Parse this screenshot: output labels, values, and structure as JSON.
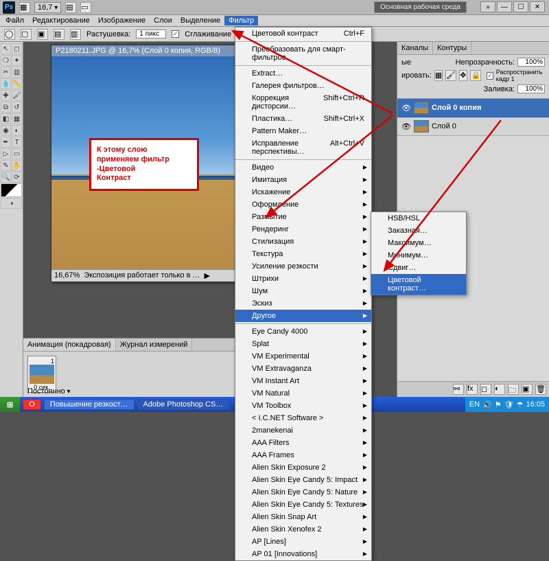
{
  "top": {
    "zoom_field": "16,7",
    "workspace_badge": "Основная рабочая среда"
  },
  "menu": {
    "file": "Файл",
    "edit": "Редактирование",
    "image": "Изображение",
    "layer": "Слои",
    "select": "Выделение",
    "filter": "Фильтр"
  },
  "options": {
    "feather_label": "Растушевка:",
    "feather_val": "1 пикс",
    "antialias": "Сглаживание"
  },
  "doc": {
    "title": "P2180211.JPG @ 16,7% (Слой 0 копия, RGB/8)",
    "zoom": "16,67%",
    "status": "Экспозиция работает только в …"
  },
  "annot": {
    "l1": "К этому слою",
    "l2": "применяем фильтр",
    "l3": "-Цветовой",
    "l4": "Контраст"
  },
  "panels": {
    "tab_channels": "Каналы",
    "tab_paths": "Контуры",
    "tab_layers_hint": "ые",
    "opacity_label": "Непрозрачность:",
    "opacity_val": "100%",
    "fill_label": "Заливка:",
    "fill_val": "100%",
    "lock_label": "ировать:",
    "propagate": "Распространить кадр 1",
    "layer_top": "Слой 0 копия",
    "layer_bottom": "Слой 0"
  },
  "anim": {
    "tab1": "Анимация (покадровая)",
    "tab2": "Журнал измерений",
    "frame_num": "1",
    "frame_time": "0 сек.",
    "loop": "Постоянно"
  },
  "filter_menu": {
    "last": "Цветовой контраст",
    "last_sc": "Ctrl+F",
    "smart": "Преобразовать для смарт-фильтров",
    "extract": "Extract…",
    "gallery": "Галерея фильтров…",
    "lens": "Коррекция дисторсии…",
    "lens_sc": "Shift+Ctrl+R",
    "liquify": "Пластика…",
    "liquify_sc": "Shift+Ctrl+X",
    "pattern": "Pattern Maker…",
    "vanish": "Исправление перспективы…",
    "vanish_sc": "Alt+Ctrl+V",
    "g_video": "Видео",
    "g_imit": "Имитация",
    "g_dist": "Искажение",
    "g_deco": "Оформление",
    "g_blur": "Размытие",
    "g_render": "Рендеринг",
    "g_styl": "Стилизация",
    "g_tex": "Текстура",
    "g_sharp": "Усиление резкости",
    "g_stroke": "Штрихи",
    "g_noise": "Шум",
    "g_sketch": "Эскиз",
    "g_other": "Другое",
    "p1": "Eye Candy 4000",
    "p2": "Splat",
    "p3": "VM Experimental",
    "p4": "VM Extravaganza",
    "p5": "VM Instant Art",
    "p6": "VM Natural",
    "p7": "VM Toolbox",
    "p8": "< I.C.NET Software >",
    "p9": "2manekenai",
    "p10": "AAA Filters",
    "p11": "AAA Frames",
    "p12": "Alien Skin Exposure 2",
    "p13": "Alien Skin Eye Candy 5: Impact",
    "p14": "Alien Skin Eye Candy 5: Nature",
    "p15": "Alien Skin Eye Candy 5: Textures",
    "p16": "Alien Skin Snap Art",
    "p17": "Alien Skin Xenofex 2",
    "p18": "AP [Lines]",
    "p19": "AP 01 [Innovations]"
  },
  "submenu": {
    "hsb": "HSB/HSL",
    "custom": "Заказная…",
    "max": "Максимум…",
    "min": "Минимум…",
    "offset": "Сдвиг…",
    "highpass": "Цветовой контраст…"
  },
  "taskbar": {
    "t1": "Повышение резкост…",
    "t2": "Adobe Photoshop CS…",
    "lang": "EN",
    "time": "16:05"
  }
}
